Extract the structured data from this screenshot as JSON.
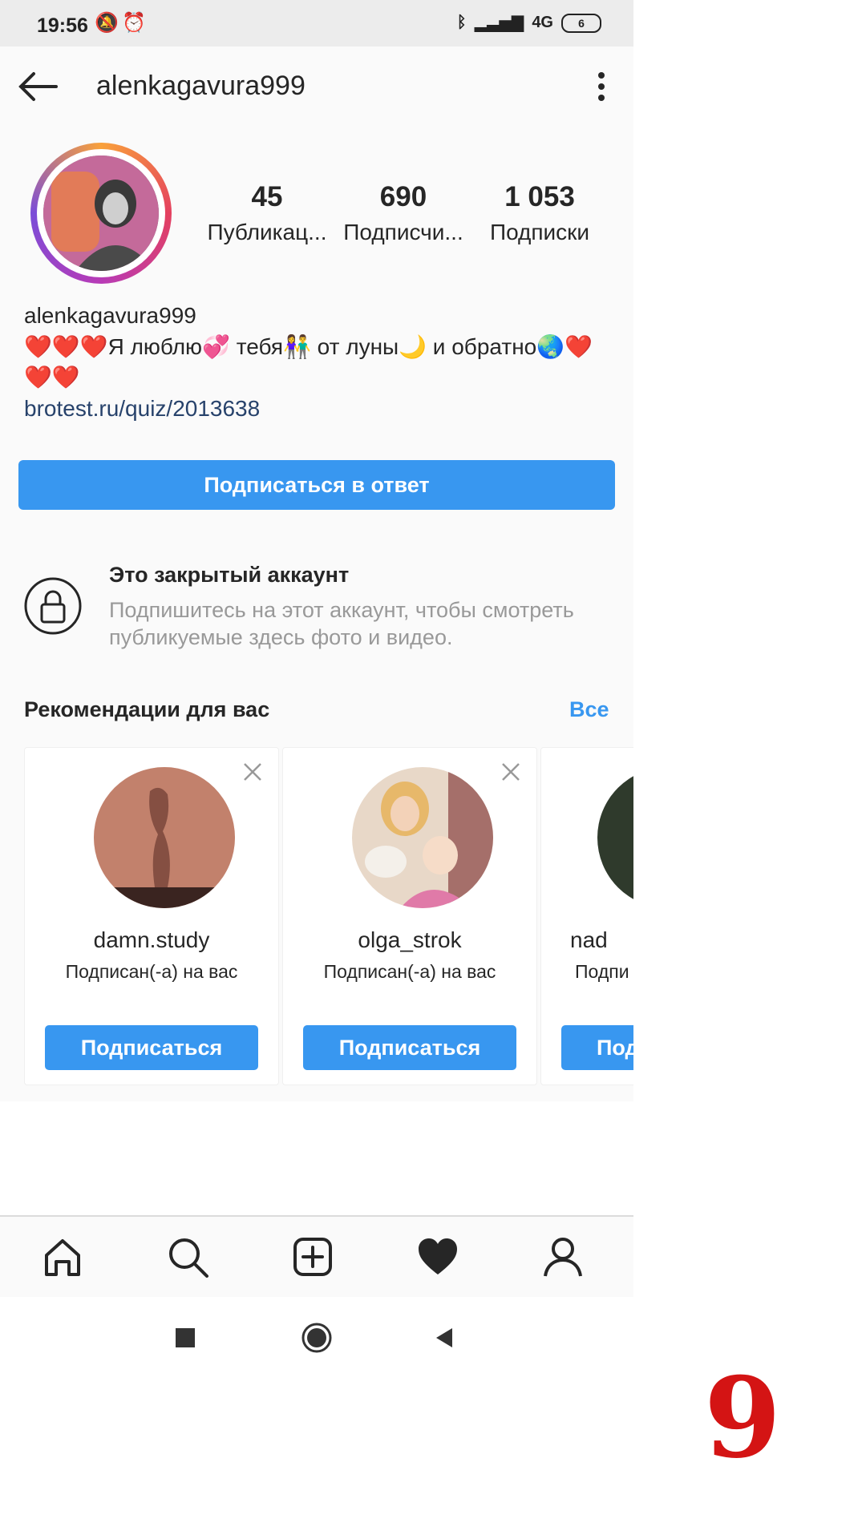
{
  "status_bar": {
    "time": "19:56",
    "network": "4G",
    "battery": "6"
  },
  "header": {
    "username": "alenkagavura999"
  },
  "stats": [
    {
      "value": "45",
      "label": "Публикац..."
    },
    {
      "value": "690",
      "label": "Подписчи..."
    },
    {
      "value": "1 053",
      "label": "Подписки"
    }
  ],
  "bio": {
    "name": "alenkagavura999",
    "text": "❤️❤️❤️Я люблю💞 тебя👫 от луны🌙 и обратно🌏❤️❤️❤️",
    "link": "brotest.ru/quiz/2013638"
  },
  "follow_back_label": "Подписаться в ответ",
  "private": {
    "title": "Это закрытый аккаунт",
    "description": "Подпишитесь на этот аккаунт, чтобы смотреть публикуемые здесь фото и видео."
  },
  "recommendations": {
    "title": "Рекомендации для вас",
    "see_all": "Все",
    "cards": [
      {
        "username": "damn.study",
        "subtitle": "Подписан(-а) на вас",
        "button": "Подписаться"
      },
      {
        "username": "olga_strok",
        "subtitle": "Подписан(-а) на вас",
        "button": "Подписаться"
      },
      {
        "username": "nad",
        "subtitle": "Подпи",
        "button": "Под"
      }
    ]
  },
  "corner_badge": "9",
  "colors": {
    "accent": "#3897f0",
    "badge": "#d41414",
    "link": "#27426b"
  }
}
